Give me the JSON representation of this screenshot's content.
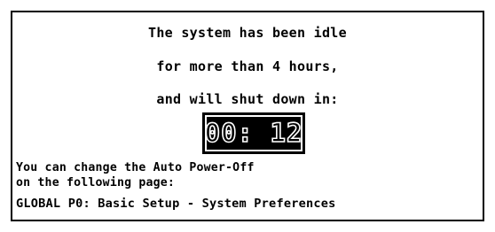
{
  "dialog": {
    "message_lines": [
      "The system has been idle",
      "for more than 4 hours,",
      "and will shut down in:"
    ],
    "countdown": "00: 12",
    "info_lines": [
      "You can change the Auto Power-Off",
      "on the following page:",
      "GLOBAL P0: Basic Setup - System Preferences"
    ]
  },
  "colors": {
    "background": "#ffffff",
    "foreground": "#000000",
    "timer_background": "#000000",
    "timer_digits": "#ffffff"
  }
}
